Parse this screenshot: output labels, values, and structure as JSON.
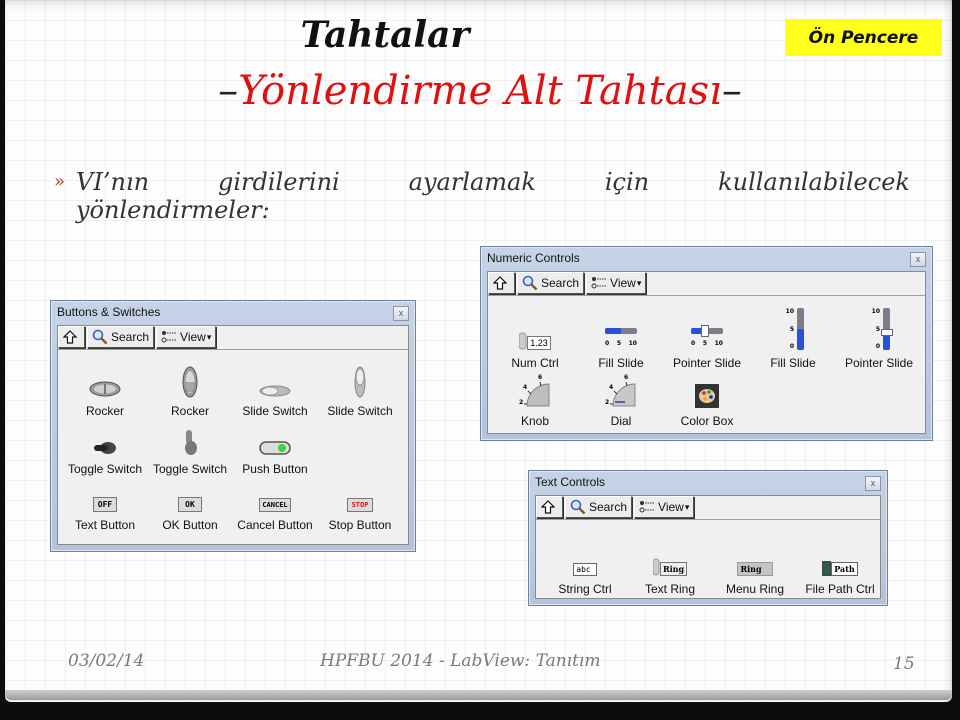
{
  "slide": {
    "title": "Tahtalar",
    "subtitle_dash_left": "–",
    "subtitle": "Yönlendirme Alt Tahtası",
    "subtitle_dash_right": "–",
    "badge": "Ön Pencere",
    "bullet_marker": "»",
    "bullet_line1": [
      "VI’nın",
      "girdilerini",
      "ayarlamak",
      "için",
      "kullanılabilecek"
    ],
    "bullet_line2": "yönlendirmeler:",
    "footer": {
      "date": "03/02/14",
      "title": "HPFBU 2014 - LabView: Tanıtım",
      "page": "15"
    },
    "colors": {
      "title_red": "#e01010",
      "badge_yellow": "#ffff1a",
      "bullet_marker": "#a0391e"
    }
  },
  "toolbar": {
    "up_icon": "up-arrow-icon",
    "search_label": "Search",
    "search_icon": "magnifier-icon",
    "view_label": "View",
    "view_icon": "view-list-icon",
    "view_caret": "▾"
  },
  "palettes": {
    "buttons": {
      "title": "Buttons & Switches",
      "close": "x",
      "items": [
        {
          "label": "Rocker",
          "icon": "rocker-horizontal-icon"
        },
        {
          "label": "Rocker",
          "icon": "rocker-vertical-icon"
        },
        {
          "label": "Slide Switch",
          "icon": "slide-switch-horizontal-icon"
        },
        {
          "label": "Slide Switch",
          "icon": "slide-switch-vertical-icon"
        },
        {
          "label": "Toggle Switch",
          "icon": "toggle-switch-horizontal-icon"
        },
        {
          "label": "Toggle Switch",
          "icon": "toggle-switch-vertical-icon"
        },
        {
          "label": "Push Button",
          "icon": "push-button-icon"
        },
        {
          "label": "Text Button",
          "icon": "text-button-icon",
          "face": "OFF"
        },
        {
          "label": "OK Button",
          "icon": "ok-button-icon",
          "face": "OK"
        },
        {
          "label": "Cancel Button",
          "icon": "cancel-button-icon",
          "face": "CANCEL"
        },
        {
          "label": "Stop Button",
          "icon": "stop-button-icon",
          "face": "STOP"
        }
      ]
    },
    "numeric": {
      "title": "Numeric Controls",
      "close": "x",
      "items": [
        {
          "label": "Num Ctrl",
          "icon": "numeric-control-icon",
          "face": "1.23"
        },
        {
          "label": "Fill Slide",
          "icon": "horizontal-fill-slide-icon",
          "ticks": [
            "0",
            "5",
            "10"
          ]
        },
        {
          "label": "Pointer Slide",
          "icon": "horizontal-pointer-slide-icon",
          "ticks": [
            "0",
            "5",
            "10"
          ]
        },
        {
          "label": "Fill Slide",
          "icon": "vertical-fill-slide-icon",
          "ticks": [
            "10",
            "5",
            "0"
          ]
        },
        {
          "label": "Pointer Slide",
          "icon": "vertical-pointer-slide-icon",
          "ticks": [
            "10",
            "5",
            "0"
          ]
        },
        {
          "label": "Knob",
          "icon": "knob-icon",
          "ticks": [
            "2",
            "4",
            "6"
          ]
        },
        {
          "label": "Dial",
          "icon": "dial-icon",
          "ticks": [
            "2",
            "4",
            "6"
          ]
        },
        {
          "label": "Color Box",
          "icon": "color-box-icon"
        }
      ]
    },
    "text": {
      "title": "Text Controls",
      "close": "x",
      "items": [
        {
          "label": "String Ctrl",
          "icon": "string-control-icon",
          "face": "abc"
        },
        {
          "label": "Text Ring",
          "icon": "text-ring-icon",
          "face": "Ring"
        },
        {
          "label": "Menu Ring",
          "icon": "menu-ring-icon",
          "face": "Ring"
        },
        {
          "label": "File Path Ctrl",
          "icon": "file-path-control-icon",
          "face": "Path"
        }
      ]
    }
  }
}
